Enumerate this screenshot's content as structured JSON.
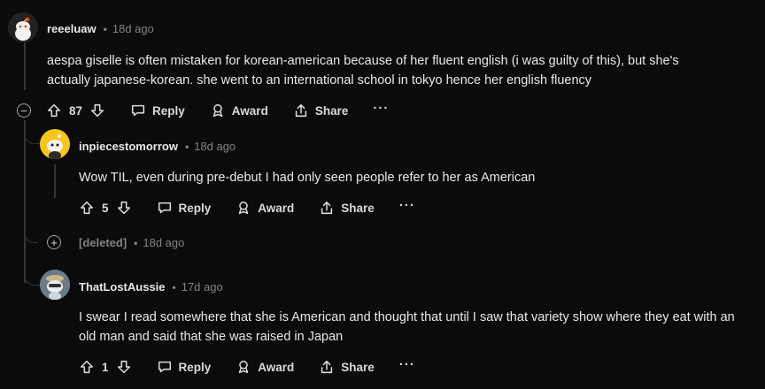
{
  "comments": [
    {
      "username": "reeeluaw",
      "time": "18d ago",
      "body": "aespa giselle is often mistaken for korean-american because of her fluent english (i was guilty of this), but she's actually japanese-korean. she went to an international school in tokyo hence her english fluency",
      "votes": "87",
      "reply": "Reply",
      "award": "Award",
      "share": "Share",
      "more": "···",
      "avatar_colors": {
        "bg": "#2a2a2a",
        "accent": "#ff4500"
      }
    },
    {
      "username": "inpiecestomorrow",
      "time": "18d ago",
      "body": "Wow TIL, even during pre-debut I had only seen people refer to her as American",
      "votes": "5",
      "reply": "Reply",
      "award": "Award",
      "share": "Share",
      "more": "···",
      "avatar_colors": {
        "bg": "#f5c518",
        "accent": "#1a1a1a"
      }
    },
    {
      "deleted_label": "[deleted]",
      "time": "18d ago"
    },
    {
      "username": "ThatLostAussie",
      "time": "17d ago",
      "body": "I swear I read somewhere that she is American and thought that until I saw that variety show where they eat with an old man and said that she was raised in Japan",
      "votes": "1",
      "reply": "Reply",
      "award": "Award",
      "share": "Share",
      "more": "···",
      "avatar_colors": {
        "bg": "#9aa6b0",
        "accent": "#e9eef2"
      }
    }
  ],
  "separator": "•",
  "collapse_symbol": "−",
  "expand_symbol": "+"
}
